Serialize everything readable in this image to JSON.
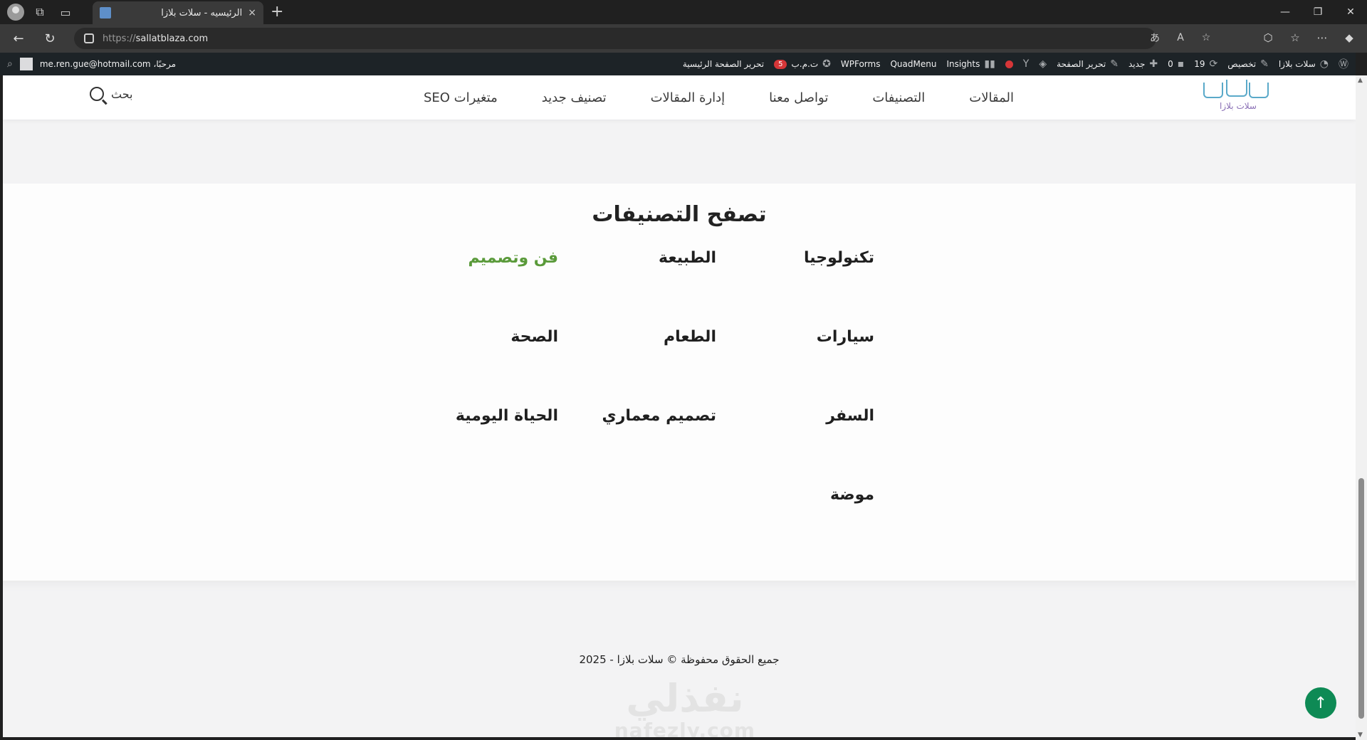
{
  "browser": {
    "tab_title": "الرئيسيه - سلات بلازا",
    "tab_close": "×",
    "new_tab": "+",
    "url_scheme": "https://",
    "url_host": "sallatblaza.com",
    "window_controls": [
      "—",
      "❐",
      "✕"
    ]
  },
  "wp_admin_bar": {
    "site_name": "سلات بلازا",
    "customize": "تخصيص",
    "updates_count": "19",
    "comments_count": "0",
    "new": "جديد",
    "edit_page": "تحرير الصفحة",
    "insights": "Insights",
    "quadmenu": "QuadMenu",
    "wpforms": "WPForms",
    "seo_label": "ت.م.ب",
    "seo_badge": "5",
    "edit_home": "تحرير الصفحة الرئيسية",
    "greeting": "مرحبًا، me.ren.gue@hotmail.com"
  },
  "header": {
    "logo_text": "سلات بلازا",
    "nav": [
      "المقالات",
      "التصنيفات",
      "تواصل معنا",
      "إدارة المقالات",
      "تصنيف جديد",
      "متغيرات SEO"
    ],
    "search_label": "بحث"
  },
  "categories_section": {
    "title": "تصفح التصنيفات",
    "items": [
      "تكنولوجيا",
      "الطبيعة",
      "فن وتصميم",
      "سيارات",
      "الطعام",
      "الصحة",
      "السفر",
      "تصميم معماري",
      "الحياة اليومية",
      "موضة"
    ],
    "highlight_color": "#5a9a3a"
  },
  "footer": {
    "copyright": "جميع الحقوق محفوظة © سلات بلازا - 2025",
    "watermark_ar": "نفذلي",
    "watermark_en": "nafezly.com",
    "to_top_icon": "↑"
  },
  "colors": {
    "wp_bar": "#1d2327",
    "accent_green": "#0e8a55",
    "page_bg": "#f3f3f4"
  }
}
